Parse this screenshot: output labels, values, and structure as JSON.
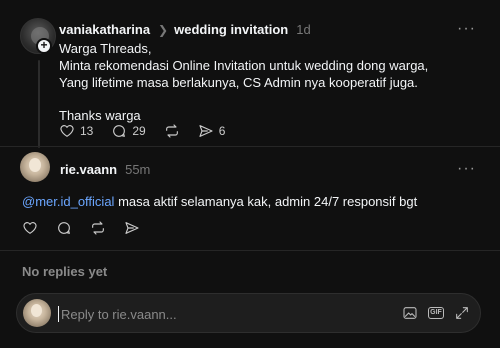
{
  "post": {
    "username": "vaniakatharina",
    "topic": "wedding invitation",
    "time": "1d",
    "more": "···",
    "lines": [
      "Warga Threads,",
      "Minta rekomendasi Online Invitation untuk wedding dong warga,",
      "Yang lifetime masa berlakunya, CS Admin nya kooperatif juga."
    ],
    "closing": "Thanks warga",
    "likes": "13",
    "comments": "29",
    "shares": "6"
  },
  "reply": {
    "username": "rie.vaann",
    "time": "55m",
    "more": "···",
    "mention": "@mer.id_official",
    "text": " masa aktif selamanya kak, admin 24/7 responsif bgt"
  },
  "no_replies_label": "No replies yet",
  "reply_box": {
    "placeholder": "Reply to rie.vaann..."
  }
}
